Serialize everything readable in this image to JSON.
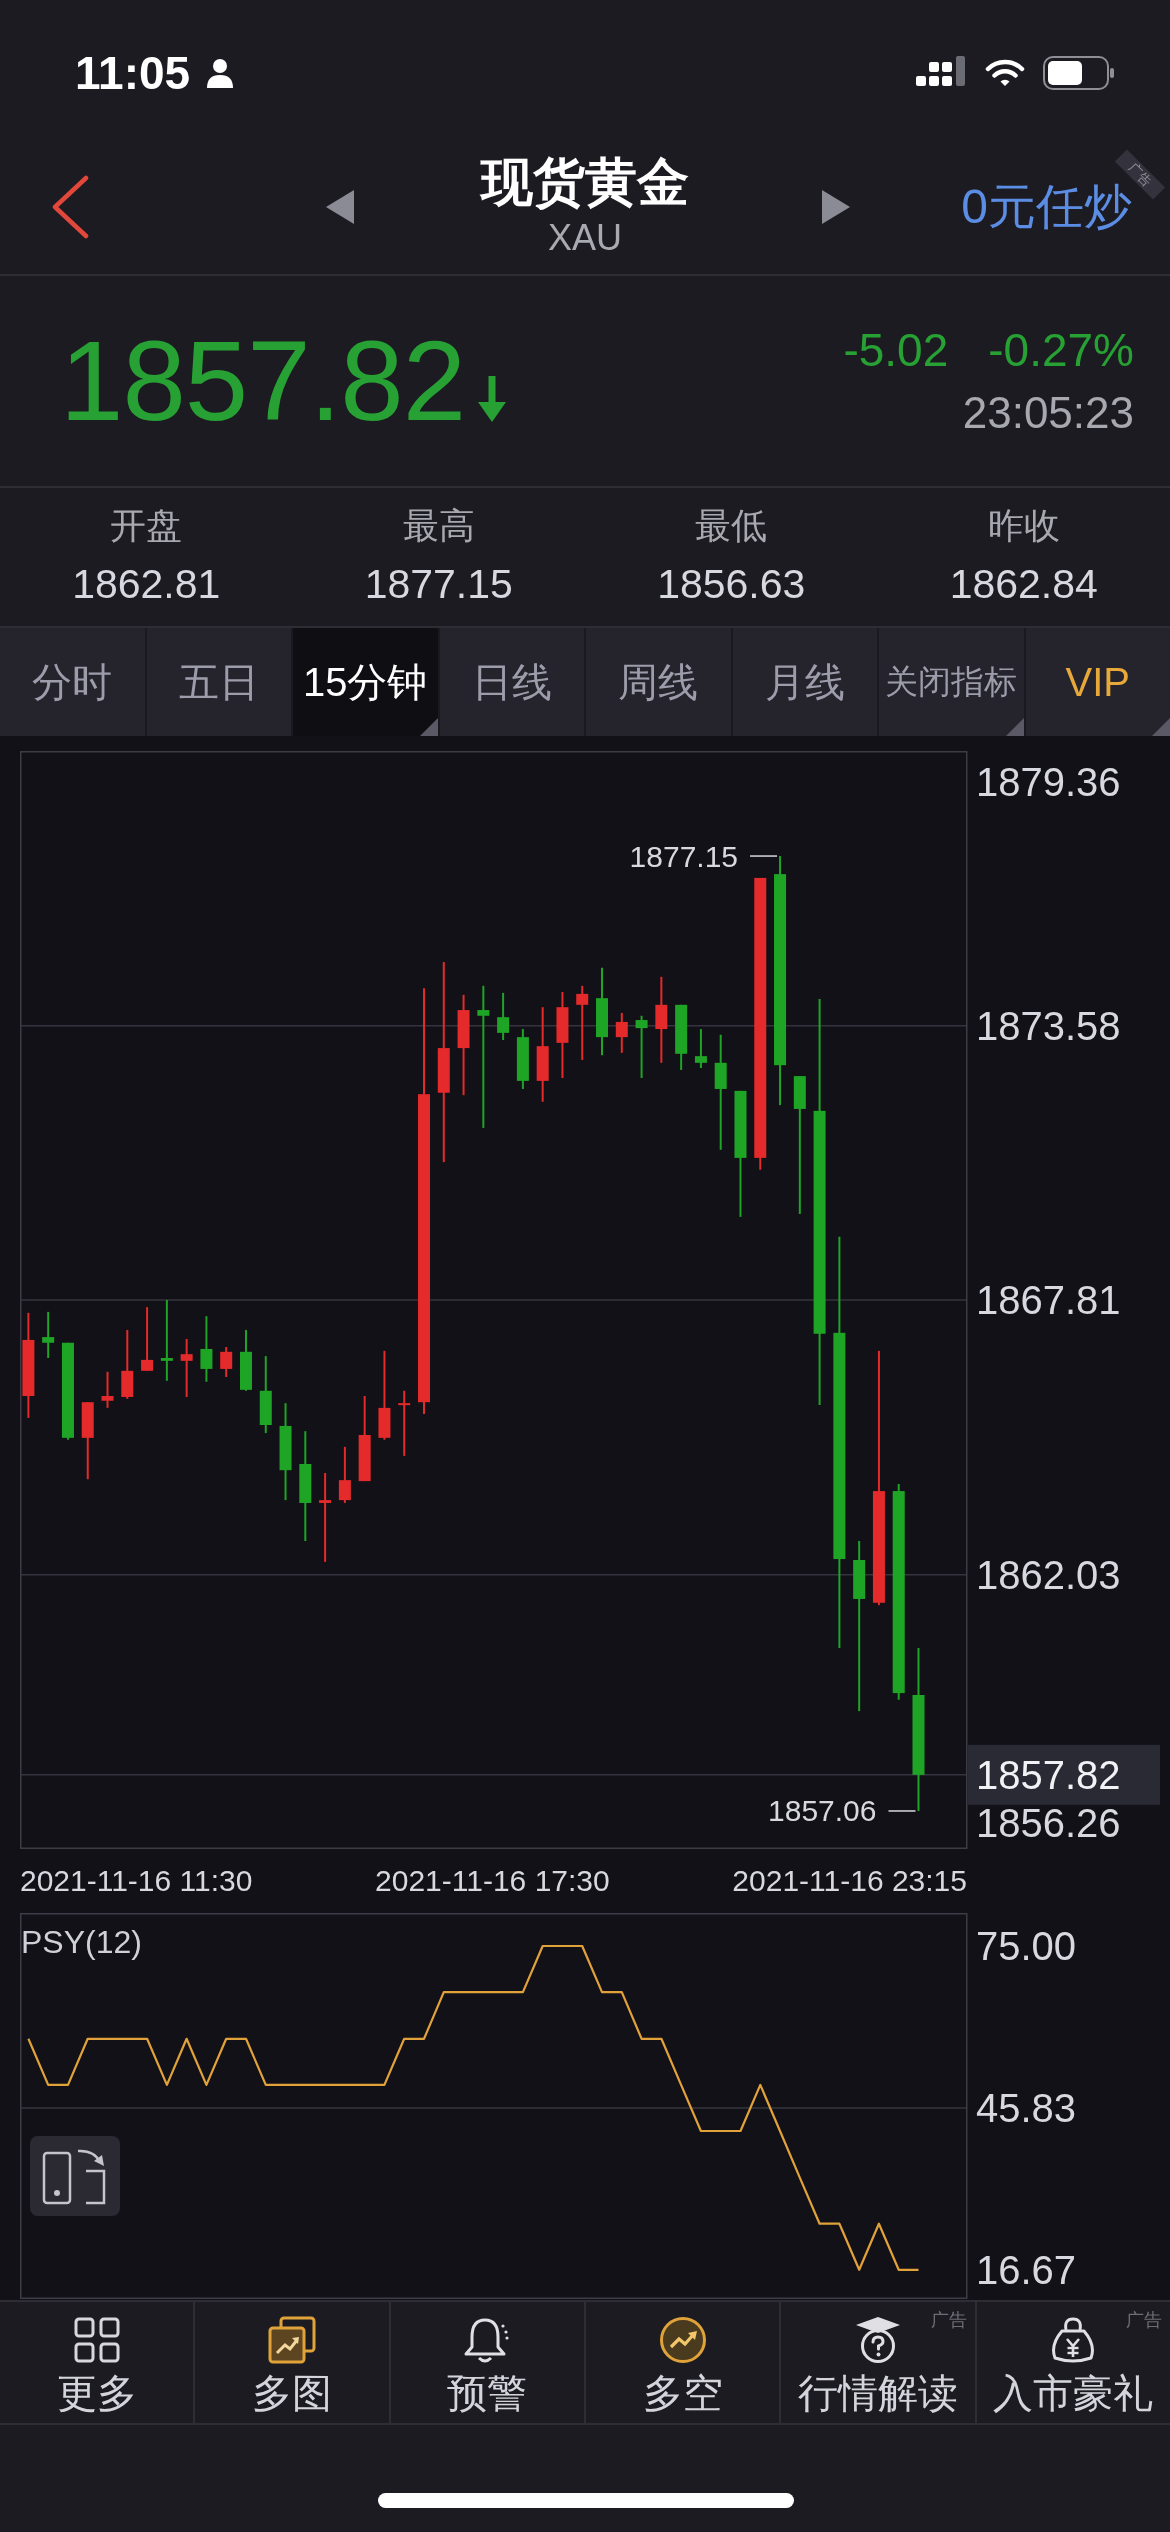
{
  "status_bar": {
    "time": "11:05"
  },
  "header": {
    "title": "现货黄金",
    "symbol": "XAU",
    "promo": "0元任炒",
    "corner_tag": "广告"
  },
  "quote": {
    "price": "1857.82",
    "falling": true,
    "change": "-5.02",
    "change_percent": "-0.27%",
    "time": "23:05:23"
  },
  "stats": [
    {
      "label": "开盘",
      "value": "1862.81"
    },
    {
      "label": "最高",
      "value": "1877.15"
    },
    {
      "label": "最低",
      "value": "1856.63"
    },
    {
      "label": "昨收",
      "value": "1862.84"
    }
  ],
  "tabs": [
    {
      "label": "分时",
      "selected": false,
      "kind": "period",
      "menu": false
    },
    {
      "label": "五日",
      "selected": false,
      "kind": "period",
      "menu": false
    },
    {
      "label": "15分钟",
      "selected": true,
      "kind": "period",
      "menu": true
    },
    {
      "label": "日线",
      "selected": false,
      "kind": "period",
      "menu": false
    },
    {
      "label": "周线",
      "selected": false,
      "kind": "period",
      "menu": false
    },
    {
      "label": "月线",
      "selected": false,
      "kind": "period",
      "menu": false
    },
    {
      "label": "关闭指标",
      "selected": false,
      "kind": "option",
      "menu": true
    },
    {
      "label": "VIP",
      "selected": false,
      "kind": "vip",
      "menu": true
    }
  ],
  "price_chart": {
    "top_label": "1879.36",
    "high_marker": "1877.15",
    "low_marker": "1857.06",
    "bottom_label": "1856.26",
    "time_labels": [
      "2021-11-16 11:30",
      "2021-11-16 17:30",
      "2021-11-16 23:15"
    ],
    "chart_data": {
      "type": "candlestick",
      "ohlc": [
        [
          1865.79,
          1867.54,
          1865.33,
          1866.97
        ],
        [
          1867.03,
          1867.56,
          1866.59,
          1866.91
        ],
        [
          1866.91,
          1866.91,
          1864.87,
          1864.91
        ],
        [
          1864.91,
          1865.66,
          1864.04,
          1865.66
        ],
        [
          1865.69,
          1866.3,
          1865.54,
          1865.79
        ],
        [
          1865.77,
          1867.18,
          1865.73,
          1866.32
        ],
        [
          1866.32,
          1867.66,
          1866.32,
          1866.55
        ],
        [
          1866.59,
          1867.81,
          1866.11,
          1866.53
        ],
        [
          1866.53,
          1866.99,
          1865.77,
          1866.67
        ],
        [
          1866.78,
          1867.47,
          1866.09,
          1866.36
        ],
        [
          1866.36,
          1866.82,
          1866.19,
          1866.72
        ],
        [
          1866.72,
          1867.18,
          1865.9,
          1865.92
        ],
        [
          1865.9,
          1866.63,
          1865.01,
          1865.18
        ],
        [
          1865.16,
          1865.64,
          1863.6,
          1864.23
        ],
        [
          1864.36,
          1865.05,
          1862.74,
          1863.54
        ],
        [
          1863.54,
          1864.17,
          1862.3,
          1863.6
        ],
        [
          1863.6,
          1864.72,
          1863.54,
          1864.02
        ],
        [
          1864.0,
          1865.79,
          1864.0,
          1864.97
        ],
        [
          1864.91,
          1866.74,
          1864.87,
          1865.54
        ],
        [
          1865.6,
          1865.9,
          1864.53,
          1865.64
        ],
        [
          1865.66,
          1874.37,
          1865.41,
          1872.14
        ],
        [
          1872.17,
          1874.92,
          1870.71,
          1873.11
        ],
        [
          1873.11,
          1874.23,
          1872.12,
          1873.91
        ],
        [
          1873.91,
          1874.42,
          1871.43,
          1873.79
        ],
        [
          1873.76,
          1874.27,
          1873.28,
          1873.43
        ],
        [
          1873.34,
          1873.51,
          1872.25,
          1872.42
        ],
        [
          1872.42,
          1873.97,
          1871.98,
          1873.15
        ],
        [
          1873.22,
          1874.29,
          1872.48,
          1873.97
        ],
        [
          1874.02,
          1874.42,
          1872.86,
          1874.25
        ],
        [
          1874.16,
          1874.8,
          1872.96,
          1873.34
        ],
        [
          1873.34,
          1873.85,
          1873.01,
          1873.66
        ],
        [
          1873.7,
          1873.79,
          1872.48,
          1873.53
        ],
        [
          1873.51,
          1874.61,
          1872.8,
          1874.02
        ],
        [
          1874.02,
          1874.02,
          1872.65,
          1872.99
        ],
        [
          1872.94,
          1873.51,
          1872.69,
          1872.8
        ],
        [
          1872.8,
          1873.39,
          1870.97,
          1872.25
        ],
        [
          1872.21,
          1872.21,
          1869.56,
          1870.8
        ],
        [
          1870.8,
          1876.69,
          1870.55,
          1876.69
        ],
        [
          1876.77,
          1877.15,
          1871.91,
          1872.75
        ],
        [
          1872.52,
          1872.52,
          1869.62,
          1871.83
        ],
        [
          1871.79,
          1874.14,
          1865.6,
          1867.1
        ],
        [
          1867.12,
          1869.14,
          1860.49,
          1862.36
        ],
        [
          1862.34,
          1862.74,
          1859.16,
          1861.52
        ],
        [
          1861.44,
          1866.74,
          1861.39,
          1863.79
        ],
        [
          1863.79,
          1863.94,
          1859.4,
          1859.54
        ],
        [
          1859.5,
          1860.49,
          1857.06,
          1857.82
        ]
      ],
      "ylim": [
        1856.26,
        1879.36
      ],
      "yticks": [
        {
          "value": 1873.58,
          "label": "1873.58"
        },
        {
          "value": 1867.81,
          "label": "1867.81"
        },
        {
          "value": 1862.03,
          "label": "1862.03"
        },
        {
          "value": 1857.82,
          "label": "1857.82"
        }
      ],
      "grid": true
    }
  },
  "indicator": {
    "chart_data": {
      "type": "line",
      "title": "PSY(12)",
      "values": [
        58.3,
        50,
        50,
        58.3,
        58.3,
        58.3,
        58.3,
        50,
        58.3,
        50,
        58.3,
        58.3,
        50,
        50,
        50,
        50,
        50,
        50,
        50,
        58.3,
        58.3,
        66.7,
        66.7,
        66.7,
        66.7,
        66.7,
        75,
        75,
        75,
        66.7,
        66.7,
        58.3,
        58.3,
        50,
        41.7,
        41.7,
        41.7,
        50,
        41.7,
        33.3,
        25,
        25,
        16.7,
        25,
        16.7,
        16.7
      ],
      "ylim": [
        11.45,
        80.94
      ],
      "yticks": [
        {
          "value": 75,
          "label": "75.00"
        },
        {
          "value": 45.83,
          "label": "45.83"
        },
        {
          "value": 16.67,
          "label": "16.67"
        }
      ],
      "grid": true
    }
  },
  "bottom_nav": [
    {
      "label": "更多"
    },
    {
      "label": "多图"
    },
    {
      "label": "预警"
    },
    {
      "label": "多空"
    },
    {
      "label": "行情解读",
      "ad_tag": "广告"
    },
    {
      "label": "入市豪礼",
      "ad_tag": "广告"
    }
  ]
}
